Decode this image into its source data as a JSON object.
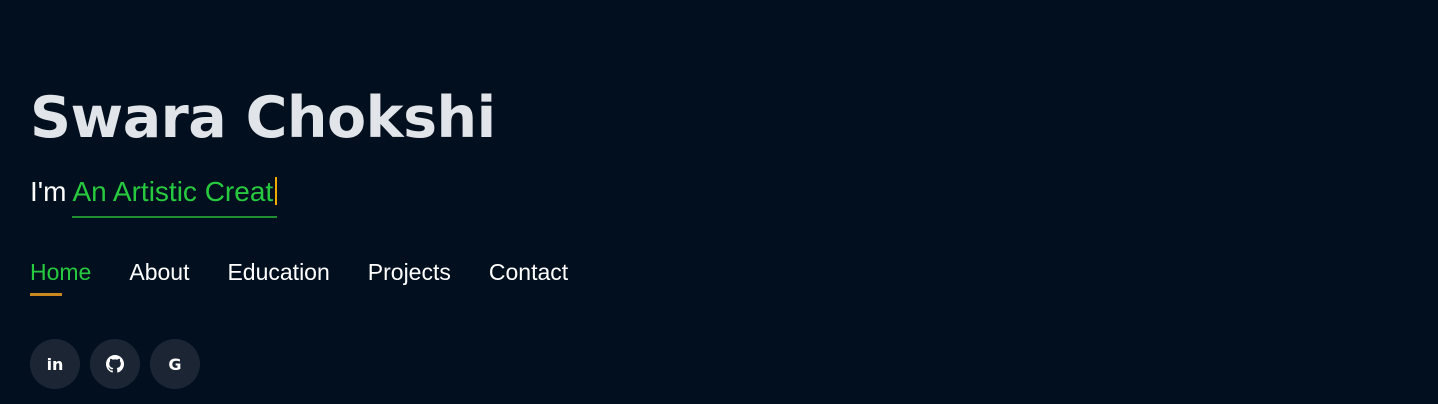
{
  "hero": {
    "name": "Swara Chokshi",
    "tagline_prefix": "I'm",
    "typed_text": "An Artistic Creat"
  },
  "nav": {
    "items": [
      {
        "label": "Home",
        "active": true
      },
      {
        "label": "About",
        "active": false
      },
      {
        "label": "Education",
        "active": false
      },
      {
        "label": "Projects",
        "active": false
      },
      {
        "label": "Contact",
        "active": false
      }
    ]
  },
  "socials": [
    {
      "icon": "linkedin-icon",
      "glyph": "in"
    },
    {
      "icon": "github-icon",
      "glyph": ""
    },
    {
      "icon": "google-icon",
      "glyph": "G"
    }
  ],
  "colors": {
    "background": "#010f1e",
    "accent_green": "#27c93f",
    "accent_gold": "#c9891f",
    "name_color": "#e1e4e8",
    "social_bg": "#1c2534"
  }
}
